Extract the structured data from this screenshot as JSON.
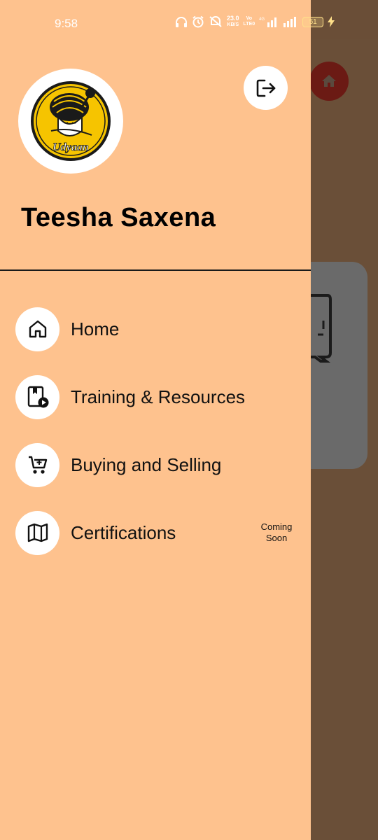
{
  "status_bar": {
    "time": "9:58",
    "speed_value": "23.0",
    "speed_unit": "KB/S",
    "network_label_top": "Vo",
    "network_label_bottom": "LTE0",
    "lte_label": "4G",
    "battery": "51"
  },
  "drawer": {
    "logo_text": "Udyaan",
    "user_name": "Teesha Saxena",
    "menu": [
      {
        "label": "Home",
        "icon": "home-icon"
      },
      {
        "label": "Training & Resources",
        "icon": "book-play-icon"
      },
      {
        "label": "Buying and Selling",
        "icon": "cart-icon"
      },
      {
        "label": "Certifications",
        "icon": "map-icon",
        "badge": "Coming Soon"
      }
    ],
    "badge_line1": "Coming",
    "badge_line2": "Soon"
  },
  "colors": {
    "drawer_bg": "#fec28e",
    "scrim": "#6a4e37",
    "home_fab": "#6b1a14",
    "logo_yellow": "#f6c400"
  }
}
